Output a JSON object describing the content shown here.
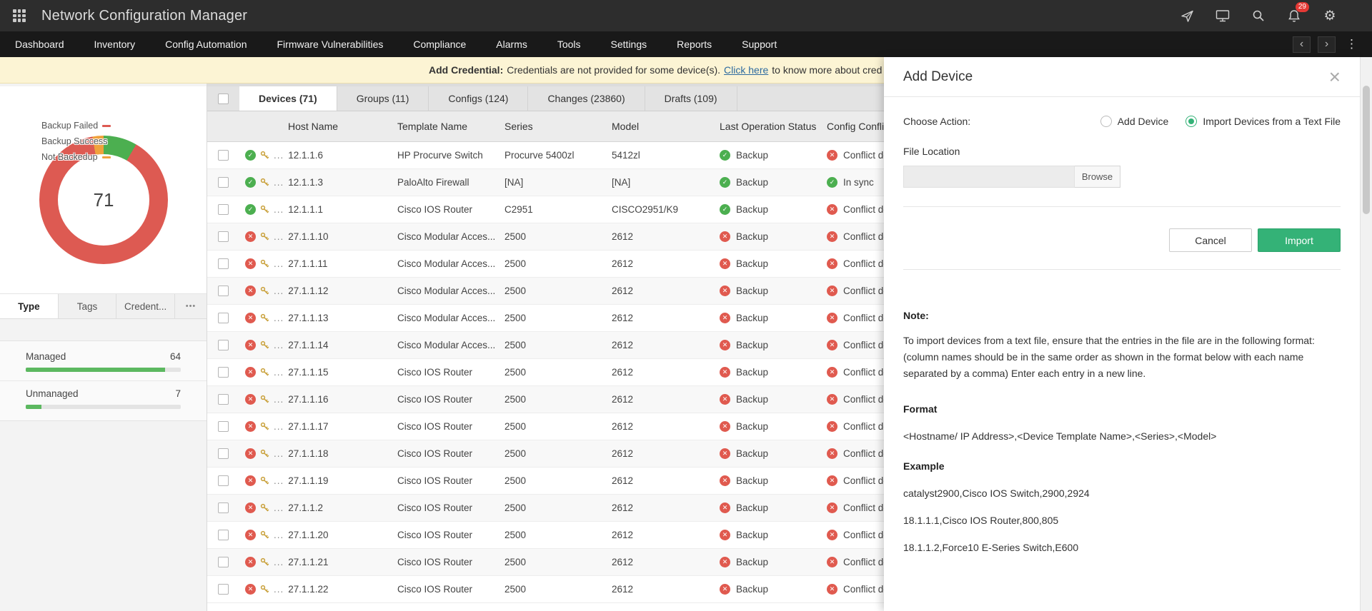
{
  "app": {
    "title": "Network Configuration Manager",
    "notification_count": "29"
  },
  "icons": {
    "more_horizontal": "•••",
    "dots_vertical": "⋮",
    "chevron_left": "‹",
    "chevron_right": "›",
    "gear": "⚙",
    "close": "×",
    "check": "✓",
    "cross": "✕"
  },
  "nav": {
    "items": [
      "Dashboard",
      "Inventory",
      "Config Automation",
      "Firmware Vulnerabilities",
      "Compliance",
      "Alarms",
      "Tools",
      "Settings",
      "Reports",
      "Support"
    ]
  },
  "banner": {
    "prefix": "Add Credential:",
    "message": "Credentials are not provided for some device(s).",
    "link": "Click here",
    "suffix": "to know more about cred"
  },
  "sidebar": {
    "donut": {
      "total": "71",
      "segments": [
        {
          "label": "Backup Failed",
          "value": 63,
          "color": "#dd5a52"
        },
        {
          "label": "Backup Success",
          "value": 6,
          "color": "#4caf50"
        },
        {
          "label": "Not Backedup",
          "value": 2,
          "color": "#f0a23c"
        }
      ]
    },
    "tabs": [
      {
        "label": "Type",
        "active": true
      },
      {
        "label": "Tags",
        "active": false
      },
      {
        "label": "Credent...",
        "active": false
      }
    ],
    "stats": [
      {
        "label": "Managed",
        "value": "64",
        "pct": 90
      },
      {
        "label": "Unmanaged",
        "value": "7",
        "pct": 10
      }
    ]
  },
  "table": {
    "tabs": [
      {
        "label": "Devices (71)",
        "active": true
      },
      {
        "label": "Groups (11)",
        "active": false
      },
      {
        "label": "Configs (124)",
        "active": false
      },
      {
        "label": "Changes (23860)",
        "active": false
      },
      {
        "label": "Drafts (109)",
        "active": false
      }
    ],
    "columns": [
      "Host Name",
      "Template Name",
      "Series",
      "Model",
      "Last Operation Status",
      "Config Conflic"
    ],
    "host_more": "...",
    "rows": [
      {
        "ip": "12.1.1.6",
        "device_status": "ok",
        "template": "HP Procurve Switch",
        "series": "Procurve 5400zl",
        "model": "5412zl",
        "last_operation": "Backup",
        "last_operation_status": "ok",
        "config_conflict": "Conflict de",
        "config_conflict_status": "error"
      },
      {
        "ip": "12.1.1.3",
        "device_status": "ok",
        "template": "PaloAlto Firewall",
        "series": "[NA]",
        "model": "[NA]",
        "last_operation": "Backup",
        "last_operation_status": "ok",
        "config_conflict": "In sync",
        "config_conflict_status": "ok"
      },
      {
        "ip": "12.1.1.1",
        "device_status": "ok",
        "template": "Cisco IOS Router",
        "series": "C2951",
        "model": "CISCO2951/K9",
        "last_operation": "Backup",
        "last_operation_status": "ok",
        "config_conflict": "Conflict de",
        "config_conflict_status": "error"
      },
      {
        "ip": "27.1.1.10",
        "device_status": "error",
        "template": "Cisco Modular Acces...",
        "series": "2500",
        "model": "2612",
        "last_operation": "Backup",
        "last_operation_status": "error",
        "config_conflict": "Conflict de",
        "config_conflict_status": "error"
      },
      {
        "ip": "27.1.1.11",
        "device_status": "error",
        "template": "Cisco Modular Acces...",
        "series": "2500",
        "model": "2612",
        "last_operation": "Backup",
        "last_operation_status": "error",
        "config_conflict": "Conflict de",
        "config_conflict_status": "error"
      },
      {
        "ip": "27.1.1.12",
        "device_status": "error",
        "template": "Cisco Modular Acces...",
        "series": "2500",
        "model": "2612",
        "last_operation": "Backup",
        "last_operation_status": "error",
        "config_conflict": "Conflict de",
        "config_conflict_status": "error"
      },
      {
        "ip": "27.1.1.13",
        "device_status": "error",
        "template": "Cisco Modular Acces...",
        "series": "2500",
        "model": "2612",
        "last_operation": "Backup",
        "last_operation_status": "error",
        "config_conflict": "Conflict de",
        "config_conflict_status": "error"
      },
      {
        "ip": "27.1.1.14",
        "device_status": "error",
        "template": "Cisco Modular Acces...",
        "series": "2500",
        "model": "2612",
        "last_operation": "Backup",
        "last_operation_status": "error",
        "config_conflict": "Conflict de",
        "config_conflict_status": "error"
      },
      {
        "ip": "27.1.1.15",
        "device_status": "error",
        "template": "Cisco IOS Router",
        "series": "2500",
        "model": "2612",
        "last_operation": "Backup",
        "last_operation_status": "error",
        "config_conflict": "Conflict de",
        "config_conflict_status": "error"
      },
      {
        "ip": "27.1.1.16",
        "device_status": "error",
        "template": "Cisco IOS Router",
        "series": "2500",
        "model": "2612",
        "last_operation": "Backup",
        "last_operation_status": "error",
        "config_conflict": "Conflict de",
        "config_conflict_status": "error"
      },
      {
        "ip": "27.1.1.17",
        "device_status": "error",
        "template": "Cisco IOS Router",
        "series": "2500",
        "model": "2612",
        "last_operation": "Backup",
        "last_operation_status": "error",
        "config_conflict": "Conflict de",
        "config_conflict_status": "error"
      },
      {
        "ip": "27.1.1.18",
        "device_status": "error",
        "template": "Cisco IOS Router",
        "series": "2500",
        "model": "2612",
        "last_operation": "Backup",
        "last_operation_status": "error",
        "config_conflict": "Conflict de",
        "config_conflict_status": "error"
      },
      {
        "ip": "27.1.1.19",
        "device_status": "error",
        "template": "Cisco IOS Router",
        "series": "2500",
        "model": "2612",
        "last_operation": "Backup",
        "last_operation_status": "error",
        "config_conflict": "Conflict de",
        "config_conflict_status": "error"
      },
      {
        "ip": "27.1.1.2",
        "device_status": "error",
        "template": "Cisco IOS Router",
        "series": "2500",
        "model": "2612",
        "last_operation": "Backup",
        "last_operation_status": "error",
        "config_conflict": "Conflict de",
        "config_conflict_status": "error"
      },
      {
        "ip": "27.1.1.20",
        "device_status": "error",
        "template": "Cisco IOS Router",
        "series": "2500",
        "model": "2612",
        "last_operation": "Backup",
        "last_operation_status": "error",
        "config_conflict": "Conflict de",
        "config_conflict_status": "error"
      },
      {
        "ip": "27.1.1.21",
        "device_status": "error",
        "template": "Cisco IOS Router",
        "series": "2500",
        "model": "2612",
        "last_operation": "Backup",
        "last_operation_status": "error",
        "config_conflict": "Conflict de",
        "config_conflict_status": "error"
      },
      {
        "ip": "27.1.1.22",
        "device_status": "error",
        "template": "Cisco IOS Router",
        "series": "2500",
        "model": "2612",
        "last_operation": "Backup",
        "last_operation_status": "error",
        "config_conflict": "Conflict de",
        "config_conflict_status": "error"
      }
    ]
  },
  "panel": {
    "title": "Add Device",
    "choose_action_label": "Choose Action:",
    "radio_options": [
      {
        "label": "Add Device",
        "selected": false
      },
      {
        "label": "Import Devices from a Text File",
        "selected": true
      }
    ],
    "file_location_label": "File Location",
    "file_input_value": "",
    "browse_label": "Browse",
    "cancel_label": "Cancel",
    "import_label": "Import",
    "note_label": "Note:",
    "note_text": "To import devices from a text file, ensure that the entries in the file are in the following format: (column names should be in the same order as shown in the format below with each name separated by a comma) Enter each entry in a new line.",
    "format_label": "Format",
    "format_value": "<Hostname/ IP Address>,<Device Template Name>,<Series>,<Model>",
    "example_label": "Example",
    "examples": [
      "catalyst2900,Cisco IOS Switch,2900,2924",
      "18.1.1.1,Cisco IOS Router,800,805",
      "18.1.1.2,Force10 E-Series Switch,E600"
    ]
  }
}
